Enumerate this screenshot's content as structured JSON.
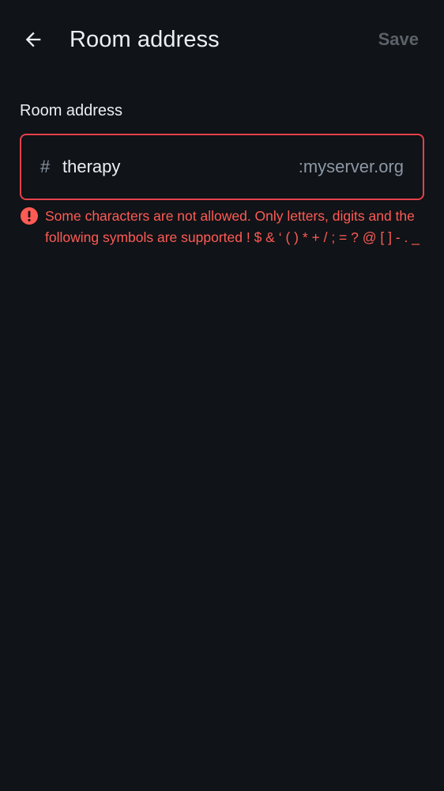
{
  "header": {
    "title": "Room address",
    "save_label": "Save",
    "back_icon": "arrow-left-icon"
  },
  "field": {
    "label": "Room address",
    "prefix": "#",
    "value": "therapy",
    "suffix": ":myserver.org"
  },
  "error": {
    "icon": "error-icon",
    "message": "Some characters are not allowed. Only letters, digits and the following symbols are supported ! $ & ‘ ( ) * + / ; = ? @ [ ] - . _"
  },
  "colors": {
    "background": "#101317",
    "text": "#ebeef2",
    "muted": "#8d97a5",
    "disabled": "#5b6168",
    "error": "#ff5b55",
    "error_border": "#e5414a"
  }
}
